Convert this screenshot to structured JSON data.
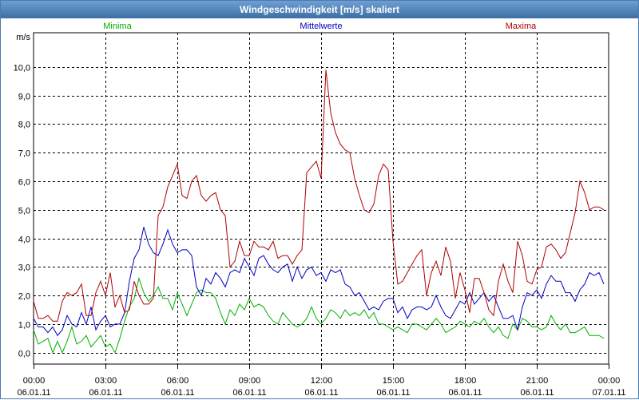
{
  "window": {
    "title": "Windgeschwindigkeit [m/s] skaliert"
  },
  "chart_data": {
    "type": "line",
    "title": "Windgeschwindigkeit [m/s] skaliert",
    "ylabel": "m/s",
    "ylim": [
      -0.4,
      11.2
    ],
    "xlim_hours": [
      0,
      24
    ],
    "grid": true,
    "legend": "top",
    "y_ticks": [
      "0,0",
      "1,0",
      "2,0",
      "3,0",
      "4,0",
      "5,0",
      "6,0",
      "7,0",
      "8,0",
      "9,0",
      "10,0"
    ],
    "x_ticks": [
      {
        "time": "00:00",
        "date": "06.01.11"
      },
      {
        "time": "03:00",
        "date": "06.01.11"
      },
      {
        "time": "06:00",
        "date": "06.01.11"
      },
      {
        "time": "09:00",
        "date": "06.01.11"
      },
      {
        "time": "12:00",
        "date": "06.01.11"
      },
      {
        "time": "15:00",
        "date": "06.01.11"
      },
      {
        "time": "18:00",
        "date": "06.01.11"
      },
      {
        "time": "21:00",
        "date": "06.01.11"
      },
      {
        "time": "00:00",
        "date": "07.01.11"
      }
    ],
    "series": [
      {
        "name": "Minima",
        "color": "#00b000",
        "x": [
          0,
          0.2,
          0.4,
          0.6,
          0.8,
          1.0,
          1.2,
          1.4,
          1.6,
          1.8,
          2.0,
          2.2,
          2.4,
          2.6,
          2.8,
          3.0,
          3.2,
          3.4,
          3.6,
          3.8,
          4.0,
          4.2,
          4.4,
          4.6,
          4.8,
          5.0,
          5.2,
          5.4,
          5.6,
          5.8,
          6.0,
          6.2,
          6.4,
          6.6,
          6.8,
          7.0,
          7.2,
          7.4,
          7.6,
          7.8,
          8.0,
          8.2,
          8.4,
          8.6,
          8.8,
          9.0,
          9.2,
          9.4,
          9.6,
          9.8,
          10.0,
          10.2,
          10.4,
          10.6,
          10.8,
          11.0,
          11.2,
          11.4,
          11.6,
          11.8,
          12.0,
          12.2,
          12.4,
          12.6,
          12.8,
          13.0,
          13.2,
          13.4,
          13.6,
          13.8,
          14.0,
          14.2,
          14.4,
          14.6,
          14.8,
          15.0,
          15.2,
          15.4,
          15.6,
          15.8,
          16.0,
          16.2,
          16.4,
          16.6,
          16.8,
          17.0,
          17.2,
          17.4,
          17.6,
          17.8,
          18.0,
          18.2,
          18.4,
          18.6,
          18.8,
          19.0,
          19.2,
          19.4,
          19.6,
          19.8,
          20.0,
          20.2,
          20.4,
          20.6,
          20.8,
          21.0,
          21.2,
          21.4,
          21.6,
          21.8,
          22.0,
          22.2,
          22.4,
          22.6,
          22.8,
          23.0,
          23.2,
          23.4,
          23.6,
          23.8
        ],
        "values": [
          0.8,
          0.3,
          0.4,
          0.5,
          0.0,
          0.4,
          0.0,
          0.4,
          0.9,
          0.3,
          0.4,
          0.6,
          0.2,
          0.4,
          0.6,
          0.2,
          0.3,
          0.0,
          0.5,
          1.1,
          1.6,
          1.9,
          2.6,
          2.1,
          1.8,
          2.0,
          2.3,
          1.9,
          1.9,
          1.5,
          2.1,
          1.7,
          1.3,
          1.7,
          2.1,
          2.2,
          2.1,
          2.1,
          1.9,
          1.4,
          1.0,
          1.5,
          1.3,
          1.7,
          1.5,
          1.9,
          1.6,
          1.7,
          1.6,
          1.3,
          1.1,
          1.0,
          1.4,
          1.2,
          1.0,
          0.9,
          1.0,
          1.2,
          1.6,
          1.2,
          1.0,
          1.2,
          1.5,
          1.4,
          1.2,
          1.5,
          1.3,
          1.4,
          1.3,
          1.5,
          1.2,
          1.4,
          1.0,
          1.0,
          0.9,
          0.8,
          0.9,
          0.8,
          0.7,
          1.0,
          1.0,
          0.9,
          0.8,
          1.0,
          1.2,
          1.0,
          0.7,
          0.8,
          0.9,
          1.1,
          1.0,
          0.9,
          1.1,
          1.0,
          1.2,
          0.9,
          0.7,
          0.9,
          0.6,
          0.5,
          1.0,
          0.8,
          1.2,
          1.1,
          0.9,
          0.9,
          0.8,
          0.9,
          1.3,
          1.0,
          0.8,
          1.0,
          0.7,
          0.7,
          0.8,
          0.9,
          0.6,
          0.6,
          0.6,
          0.5
        ]
      },
      {
        "name": "Mittelwerte",
        "color": "#0000c0",
        "x": [
          0,
          0.2,
          0.4,
          0.6,
          0.8,
          1.0,
          1.2,
          1.4,
          1.6,
          1.8,
          2.0,
          2.2,
          2.4,
          2.6,
          2.8,
          3.0,
          3.2,
          3.4,
          3.6,
          3.8,
          4.0,
          4.2,
          4.4,
          4.6,
          4.8,
          5.0,
          5.2,
          5.4,
          5.6,
          5.8,
          6.0,
          6.2,
          6.4,
          6.6,
          6.8,
          7.0,
          7.2,
          7.4,
          7.6,
          7.8,
          8.0,
          8.2,
          8.4,
          8.6,
          8.8,
          9.0,
          9.2,
          9.4,
          9.6,
          9.8,
          10.0,
          10.2,
          10.4,
          10.6,
          10.8,
          11.0,
          11.2,
          11.4,
          11.6,
          11.8,
          12.0,
          12.2,
          12.4,
          12.6,
          12.8,
          13.0,
          13.2,
          13.4,
          13.6,
          13.8,
          14.0,
          14.2,
          14.4,
          14.6,
          14.8,
          15.0,
          15.2,
          15.4,
          15.6,
          15.8,
          16.0,
          16.2,
          16.4,
          16.6,
          16.8,
          17.0,
          17.2,
          17.4,
          17.6,
          17.8,
          18.0,
          18.2,
          18.4,
          18.6,
          18.8,
          19.0,
          19.2,
          19.4,
          19.6,
          19.8,
          20.0,
          20.2,
          20.4,
          20.6,
          20.8,
          21.0,
          21.2,
          21.4,
          21.6,
          21.8,
          22.0,
          22.2,
          22.4,
          22.6,
          22.8,
          23.0,
          23.2,
          23.4,
          23.6,
          23.8
        ],
        "values": [
          1.2,
          0.9,
          0.9,
          0.7,
          0.9,
          0.6,
          0.8,
          1.3,
          1.0,
          0.9,
          1.4,
          1.0,
          1.6,
          0.8,
          1.1,
          1.3,
          0.9,
          1.0,
          1.0,
          1.4,
          2.5,
          3.3,
          3.6,
          4.4,
          3.8,
          3.5,
          3.4,
          3.8,
          4.3,
          3.8,
          3.5,
          3.6,
          3.6,
          3.4,
          2.3,
          2.0,
          2.6,
          2.4,
          2.8,
          2.6,
          2.3,
          2.8,
          2.9,
          2.8,
          3.3,
          3.0,
          2.7,
          3.3,
          3.4,
          3.1,
          2.9,
          2.8,
          3.0,
          3.1,
          2.5,
          3.0,
          2.6,
          2.9,
          3.0,
          2.7,
          2.8,
          2.5,
          2.9,
          2.8,
          2.9,
          2.4,
          2.3,
          2.0,
          2.1,
          1.8,
          1.5,
          1.6,
          1.5,
          1.8,
          1.9,
          1.9,
          1.4,
          1.6,
          1.2,
          1.5,
          1.6,
          1.6,
          1.5,
          1.6,
          2.0,
          1.6,
          1.3,
          1.2,
          1.5,
          1.8,
          1.7,
          2.1,
          1.7,
          1.9,
          2.1,
          1.8,
          2.0,
          1.6,
          1.2,
          1.2,
          1.3,
          0.8,
          1.6,
          2.1,
          2.0,
          2.2,
          1.9,
          2.4,
          2.7,
          2.5,
          2.5,
          2.1,
          2.1,
          1.8,
          2.2,
          2.4,
          2.8,
          2.7,
          2.8,
          2.4
        ]
      },
      {
        "name": "Maxima",
        "color": "#b00000",
        "x": [
          0,
          0.2,
          0.4,
          0.6,
          0.8,
          1.0,
          1.2,
          1.4,
          1.6,
          1.8,
          2.0,
          2.2,
          2.4,
          2.6,
          2.8,
          3.0,
          3.2,
          3.4,
          3.6,
          3.8,
          4.0,
          4.2,
          4.4,
          4.6,
          4.8,
          5.0,
          5.2,
          5.4,
          5.6,
          5.8,
          6.0,
          6.2,
          6.4,
          6.6,
          6.8,
          7.0,
          7.2,
          7.4,
          7.6,
          7.8,
          8.0,
          8.2,
          8.4,
          8.6,
          8.8,
          9.0,
          9.2,
          9.4,
          9.6,
          9.8,
          10.0,
          10.2,
          10.4,
          10.6,
          10.8,
          11.0,
          11.2,
          11.4,
          11.6,
          11.8,
          12.0,
          12.2,
          12.4,
          12.6,
          12.8,
          13.0,
          13.2,
          13.4,
          13.6,
          13.8,
          14.0,
          14.2,
          14.4,
          14.6,
          14.8,
          15.0,
          15.2,
          15.4,
          15.6,
          15.8,
          16.0,
          16.2,
          16.4,
          16.6,
          16.8,
          17.0,
          17.2,
          17.4,
          17.6,
          17.8,
          18.0,
          18.2,
          18.4,
          18.6,
          18.8,
          19.0,
          19.2,
          19.4,
          19.6,
          19.8,
          20.0,
          20.2,
          20.4,
          20.6,
          20.8,
          21.0,
          21.2,
          21.4,
          21.6,
          21.8,
          22.0,
          22.2,
          22.4,
          22.6,
          22.8,
          23.0,
          23.2,
          23.4,
          23.6,
          23.8
        ],
        "values": [
          1.8,
          1.2,
          1.2,
          1.3,
          1.1,
          1.1,
          1.8,
          2.1,
          2.0,
          2.1,
          2.4,
          1.3,
          1.3,
          2.1,
          2.5,
          2.0,
          2.8,
          1.6,
          2.0,
          1.4,
          1.5,
          2.5,
          2.0,
          1.7,
          1.7,
          1.9,
          4.8,
          5.1,
          5.8,
          6.2,
          6.6,
          5.5,
          5.4,
          6.0,
          6.2,
          5.5,
          5.3,
          5.5,
          5.6,
          5.0,
          4.8,
          3.0,
          3.2,
          3.9,
          3.4,
          3.4,
          3.9,
          3.7,
          3.7,
          3.6,
          3.9,
          3.3,
          3.4,
          3.4,
          3.1,
          3.4,
          3.6,
          6.3,
          6.5,
          6.7,
          6.1,
          9.9,
          8.4,
          7.7,
          7.3,
          7.1,
          7.0,
          6.1,
          5.5,
          5.0,
          4.9,
          5.2,
          6.2,
          6.6,
          6.4,
          3.9,
          2.4,
          2.5,
          2.8,
          3.1,
          3.4,
          3.6,
          2.0,
          2.8,
          3.2,
          2.7,
          3.7,
          3.2,
          1.9,
          2.8,
          2.2,
          1.4,
          2.6,
          2.6,
          2.1,
          1.5,
          1.3,
          2.5,
          3.1,
          2.5,
          2.1,
          3.9,
          3.4,
          2.5,
          2.4,
          2.9,
          3.0,
          3.7,
          3.8,
          3.6,
          3.3,
          3.5,
          4.2,
          4.9,
          6.0,
          5.6,
          5.0,
          5.1,
          5.1,
          5.0
        ]
      }
    ]
  }
}
